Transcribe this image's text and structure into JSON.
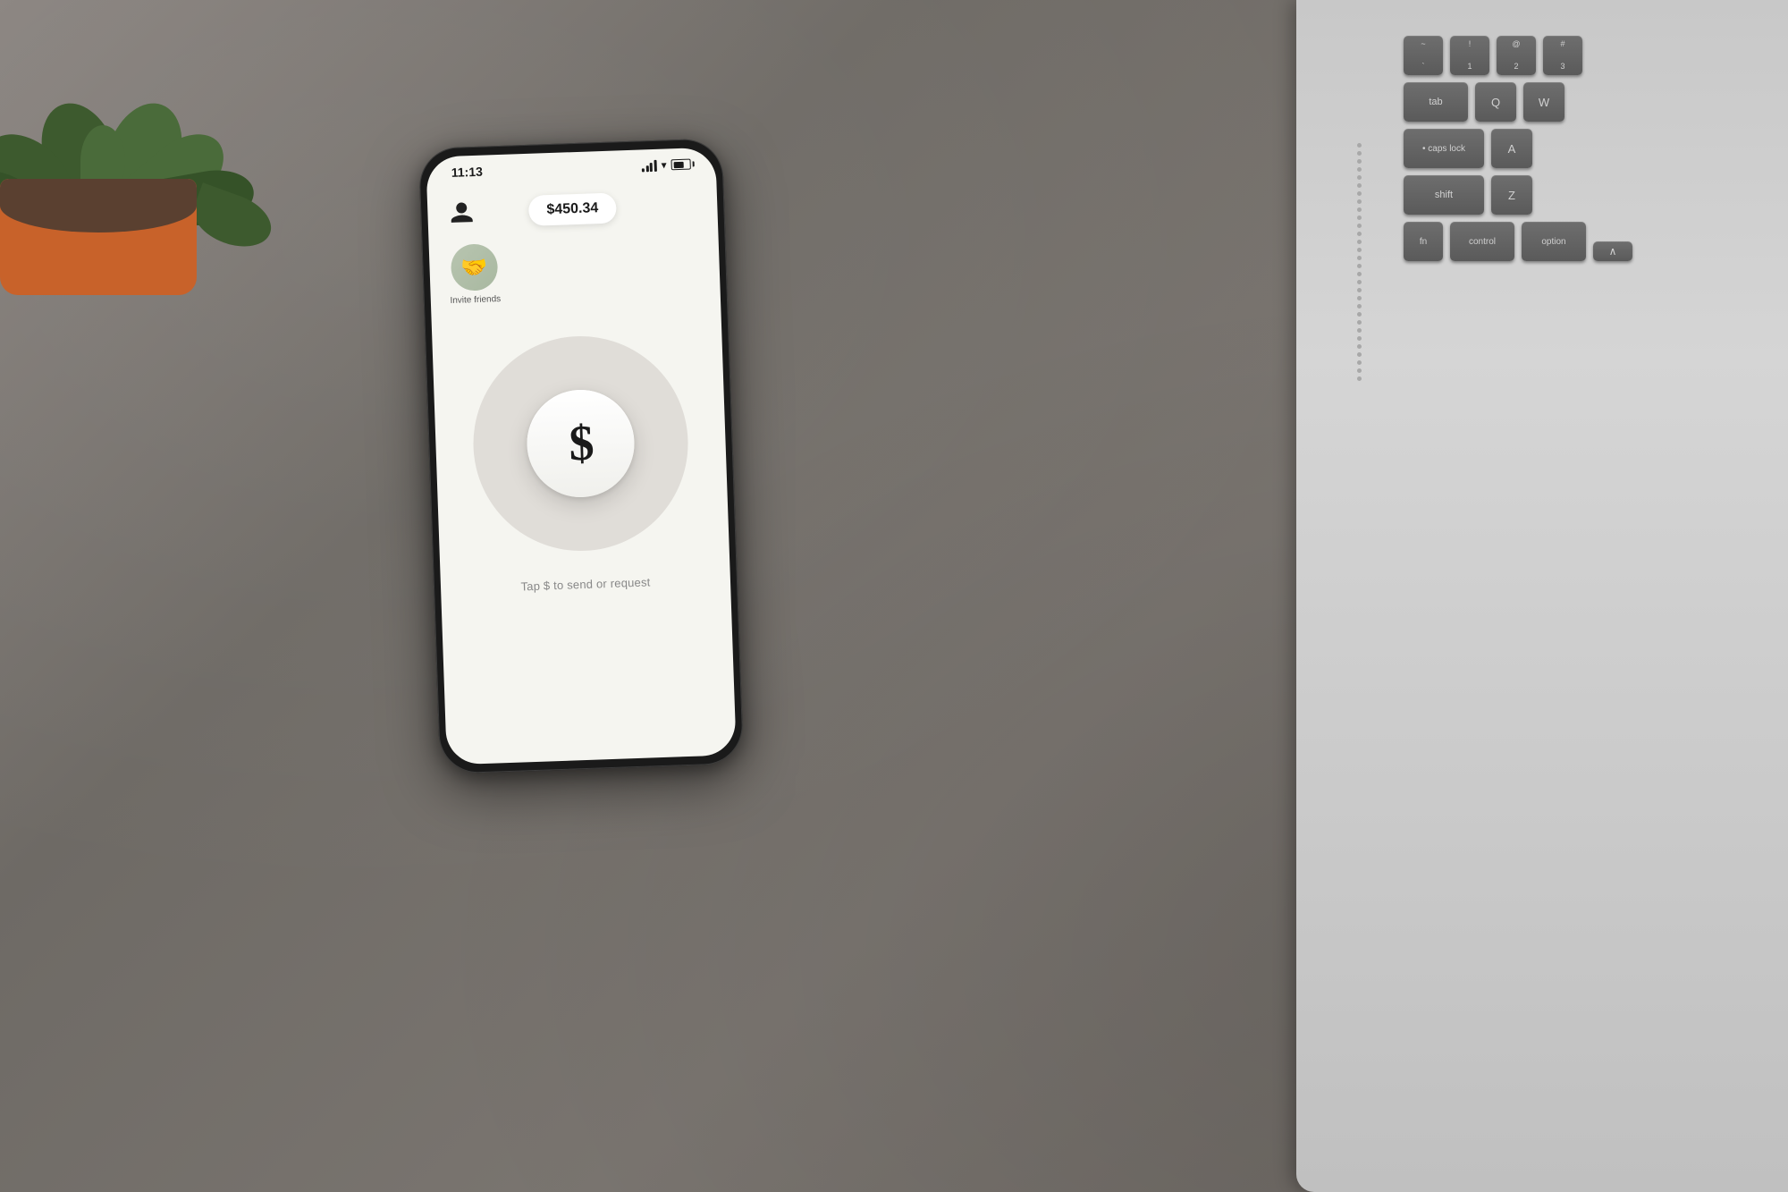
{
  "scene": {
    "background_color": "#7a7570"
  },
  "phone": {
    "status_bar": {
      "time": "11:13",
      "signal_label": "signal",
      "wifi_label": "wifi",
      "battery_label": "battery"
    },
    "header": {
      "profile_label": "profile",
      "balance": "$450.34"
    },
    "invite": {
      "icon": "🤝",
      "label": "Invite friends"
    },
    "main_button": {
      "symbol": "$",
      "hint": "Tap $ to send or request"
    }
  },
  "keyboard": {
    "rows": [
      [
        {
          "label": "~\n`",
          "size": "sm"
        },
        {
          "label": "!\n1",
          "size": "sm"
        },
        {
          "label": "@\n2",
          "size": "sm"
        },
        {
          "label": "#\n3",
          "size": "sm"
        }
      ],
      [
        {
          "label": "tab",
          "size": "lg"
        },
        {
          "label": "Q",
          "size": "letter"
        },
        {
          "label": "W",
          "size": "letter"
        }
      ],
      [
        {
          "label": "caps lock",
          "size": "xl"
        },
        {
          "label": "A",
          "size": "letter"
        }
      ],
      [
        {
          "label": "shift",
          "size": "xl"
        },
        {
          "label": "Z",
          "size": "letter"
        }
      ],
      [
        {
          "label": "fn",
          "size": "sm"
        },
        {
          "label": "control",
          "size": "lg"
        },
        {
          "label": "option",
          "size": "lg"
        }
      ]
    ]
  }
}
